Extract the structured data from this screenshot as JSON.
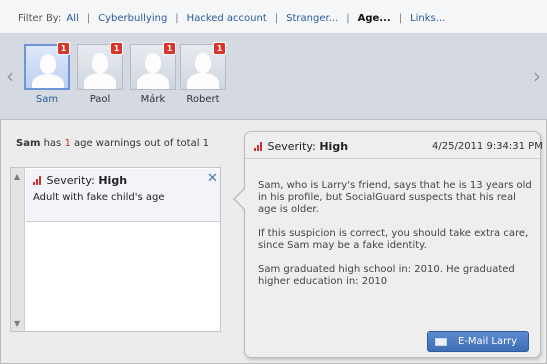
{
  "filter": {
    "label": "Filter By:",
    "items": [
      {
        "label": "All",
        "active": false
      },
      {
        "label": "Cyberbullying",
        "active": false
      },
      {
        "label": "Hacked account",
        "active": false
      },
      {
        "label": "Stranger...",
        "active": false
      },
      {
        "label": "Age...",
        "active": true
      },
      {
        "label": "Links...",
        "active": false
      }
    ],
    "separator": "|"
  },
  "children": [
    {
      "name": "Sam",
      "badge": "1",
      "selected": true
    },
    {
      "name": "Paol",
      "badge": "1",
      "selected": false
    },
    {
      "name": "Márk",
      "badge": "1",
      "selected": false
    },
    {
      "name": "Robert",
      "badge": "1",
      "selected": false
    }
  ],
  "nav": {
    "prev_glyph": "‹",
    "next_glyph": "›"
  },
  "summary": {
    "name": "Sam",
    "pre": "has",
    "count": "1",
    "post": "age warnings out of total 1"
  },
  "warning_list": {
    "items": [
      {
        "severity_label": "Severity:",
        "severity_value": "High",
        "description": "Adult with fake child's age"
      }
    ],
    "close_glyph": "✕",
    "scroll_up": "▲",
    "scroll_down": "▼"
  },
  "detail": {
    "severity_label": "Severity:",
    "severity_value": "High",
    "date": "4/25/2011 9:34:31 PM",
    "paragraphs": [
      "Sam, who is Larry's friend, says that he is 13 years old in his profile, but SocialGuard suspects that his real age is older.",
      "If this suspicion is correct, you should take extra care, since Sam may be a fake identity.",
      "Sam graduated high school in: 2010. He graduated higher education in: 2010"
    ],
    "email_button": "E-Mail Larry"
  },
  "colors": {
    "severity_high": "#d12f2f",
    "link": "#2a5a9a",
    "badge": "#d9332a",
    "button": "#4a7bc0"
  }
}
